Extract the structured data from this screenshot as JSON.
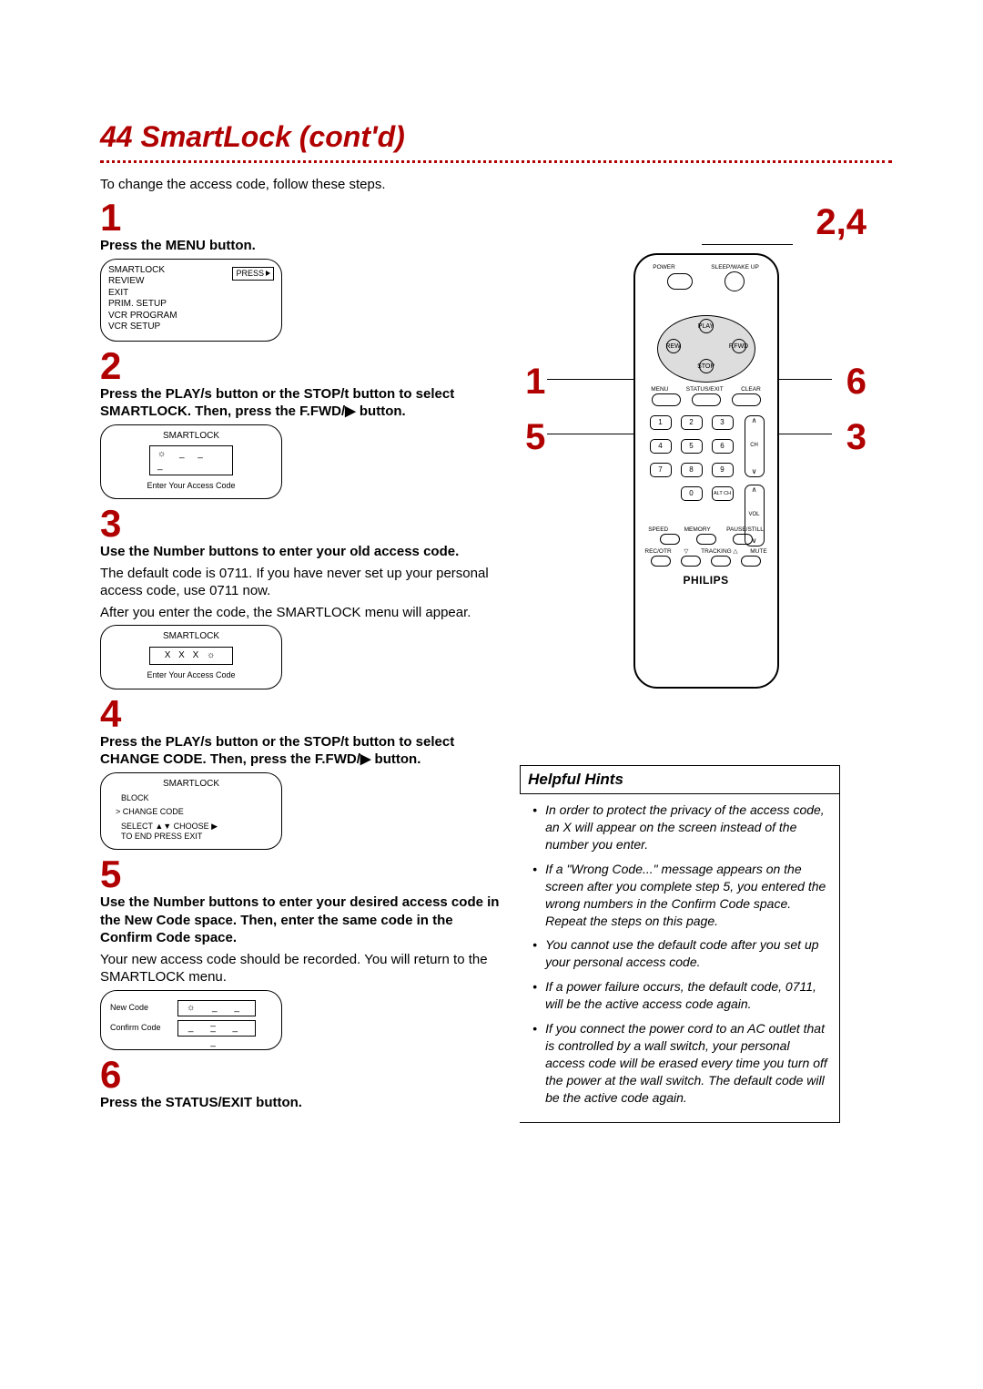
{
  "page_number": "44",
  "page_title": "SmartLock (cont'd)",
  "intro": "To change the access code, follow these steps.",
  "steps": {
    "s1": {
      "num": "1",
      "bold": "Press the MENU button."
    },
    "s2": {
      "num": "2",
      "bold": "Press the PLAY/s button or the STOP/t button to select SMARTLOCK. Then, press the F.FWD/▶ button."
    },
    "s3": {
      "num": "3",
      "bold": "Use the Number buttons to enter your old access code.",
      "p1": "The default code is 0711. If you have never set up your personal access code, use 0711 now.",
      "p2": "After you enter the code, the SMARTLOCK menu will appear."
    },
    "s4": {
      "num": "4",
      "bold": "Press the PLAY/s button or the STOP/t button to select CHANGE CODE. Then, press the F.FWD/▶ button."
    },
    "s5": {
      "num": "5",
      "bold": "Use the Number buttons to enter your desired access code in the New Code space. Then, enter the same code in the Confirm Code space.",
      "p1": "Your new access code should be recorded. You will return to the SMARTLOCK menu."
    },
    "s6": {
      "num": "6",
      "bold": "Press the STATUS/EXIT button."
    }
  },
  "screen1": {
    "menu": [
      "SMARTLOCK",
      "REVIEW",
      "EXIT",
      "PRIM. SETUP",
      "VCR PROGRAM",
      "VCR SETUP"
    ],
    "press": "PRESS"
  },
  "screen2": {
    "title": "SMARTLOCK",
    "entry": "☼ _ _ _",
    "caption": "Enter Your Access Code"
  },
  "screen3": {
    "title": "SMARTLOCK",
    "entry": "X  X  X ☼",
    "caption": "Enter Your Access Code"
  },
  "screen4": {
    "title": "SMARTLOCK",
    "item1": "BLOCK",
    "item2": "> CHANGE CODE",
    "line1": "SELECT ▲▼ CHOOSE ▶",
    "line2": "TO END PRESS EXIT"
  },
  "screen5": {
    "row1_label": "New Code",
    "row1_val": "☼ _ _ _",
    "row2_label": "Confirm Code",
    "row2_val": "_ _ _ _"
  },
  "remote": {
    "labels": {
      "power": "POWER",
      "sleepwake": "SLEEP/WAKE UP",
      "play": "PLAY",
      "rew": "REW",
      "ffwd": "F.FWD",
      "stop": "STOP",
      "menu": "MENU",
      "statusexit": "STATUS/EXIT",
      "clear": "CLEAR",
      "speed": "SPEED",
      "memory": "MEMORY",
      "pausestill": "PAUSE/STILL",
      "recotr": "REC/OTR",
      "trackingdn": "▽",
      "trackingup": "TRACKING △",
      "mute": "MUTE",
      "altch": "ALT CH",
      "ch": "CH",
      "vol": "VOL"
    },
    "numbers": [
      "1",
      "2",
      "3",
      "4",
      "5",
      "6",
      "7",
      "8",
      "9",
      "0"
    ],
    "brand": "PHILIPS"
  },
  "callouts": {
    "c24": "2,4",
    "c1": "1",
    "c5": "5",
    "c6": "6",
    "c3": "3"
  },
  "hints": {
    "title": "Helpful Hints",
    "items": [
      "In order to protect the privacy of the access code, an X will appear on the screen instead of the number you enter.",
      "If a \"Wrong Code...\" message appears on the screen after you complete step 5, you entered the wrong numbers in the Confirm Code space. Repeat the steps on this page.",
      "You cannot use the default code after you set up your personal access code.",
      "If a power failure occurs, the default code, 0711, will be the active access code again.",
      "If you connect the power cord to an AC outlet that is controlled by a wall switch, your personal access code will be erased every time you turn off the power at the wall switch. The default code will be the active code again."
    ]
  }
}
